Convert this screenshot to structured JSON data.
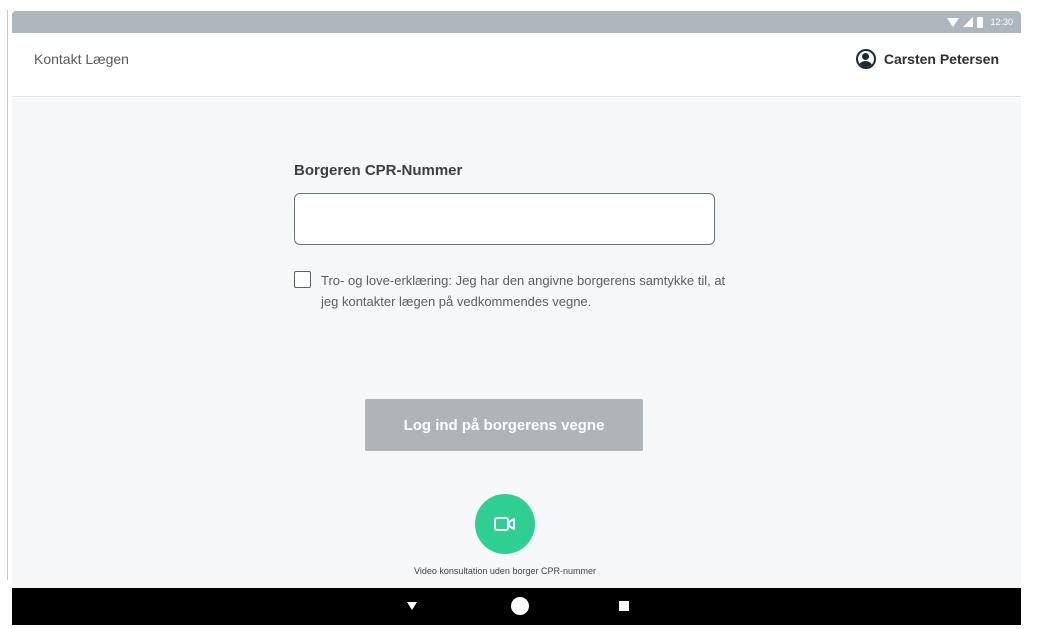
{
  "status_bar": {
    "time": "12:30"
  },
  "header": {
    "title": "Kontakt Lægen",
    "user_name": "Carsten Petersen",
    "user_icon": "user-circle-icon"
  },
  "form": {
    "cpr_label": "Borgeren CPR-Nummer",
    "cpr_value": "",
    "consent_checked": false,
    "consent_text": "Tro- og love-erklæring: Jeg har den angivne borgerens samtykke til, at jeg kontakter lægen på vedkommendes vegne.",
    "login_label": "Log ind på borgerens vegne",
    "login_enabled": false
  },
  "video": {
    "icon": "video-camera-icon",
    "caption": "Video konsultation uden borger CPR-nummer"
  },
  "colors": {
    "accent_green": "#2fcf91",
    "disabled_button": "#aeb4b8",
    "status_bar": "#aeb7bd",
    "background": "#f5f7f9"
  },
  "nav": {
    "back_icon": "back-triangle-icon",
    "home_icon": "home-circle-icon",
    "recent_icon": "recent-square-icon"
  }
}
